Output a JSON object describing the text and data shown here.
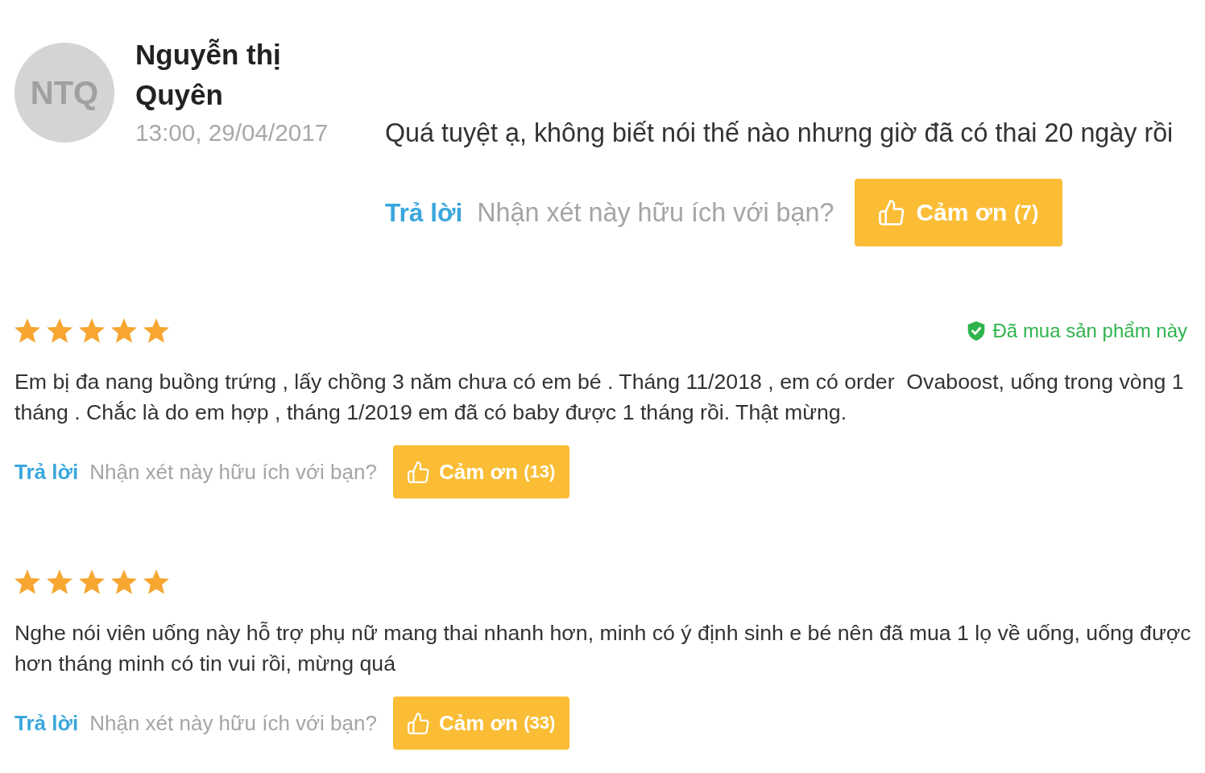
{
  "comment": {
    "avatar_initials": "NTQ",
    "author": "Nguyễn thị Quyên",
    "time": "13:00, 29/04/2017",
    "text": "Quá tuyệt ạ, không biết nói thế nào nhưng giờ đã có thai 20 ngày rồi",
    "reply_label": "Trả lời",
    "helpful_prompt": "Nhận xét này hữu ích với bạn?",
    "thanks_button": {
      "label": "Cảm ơn",
      "count": "(7)"
    }
  },
  "reviews": [
    {
      "stars": 5,
      "badge": {
        "label": "Đã mua sản phẩm này"
      },
      "text": "Em bị đa nang buồng trứng , lấy chồng 3 năm chưa có em bé . Tháng 11/2018 , em có order  Ovaboost, uống trong vòng 1 tháng . Chắc là do em hợp , tháng 1/2019 em đã có baby được 1 tháng rồi. Thật mừng.",
      "reply_label": "Trả lời",
      "helpful_prompt": "Nhận xét này hữu ích với bạn?",
      "thanks_button": {
        "label": "Cảm ơn",
        "count": "(13)"
      }
    },
    {
      "stars": 5,
      "text": "Nghe nói viên uống này hỗ trợ phụ nữ mang thai nhanh hơn, minh có ý định sinh e bé nên đã mua 1 lọ về uống, uống được hơn tháng minh có tin vui rồi, mừng quá",
      "reply_label": "Trả lời",
      "helpful_prompt": "Nhận xét này hữu ích với bạn?",
      "thanks_button": {
        "label": "Cảm ơn",
        "count": "(33)"
      }
    }
  ]
}
